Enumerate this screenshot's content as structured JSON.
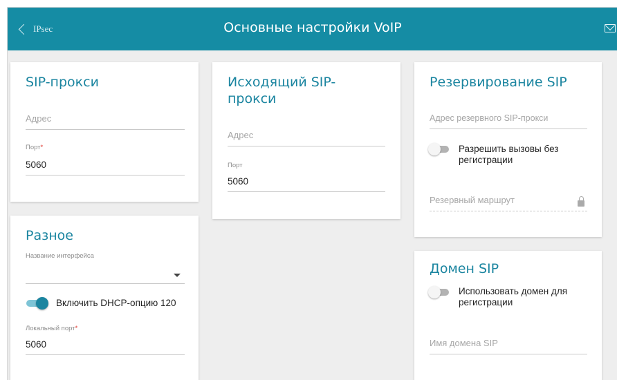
{
  "header": {
    "back_label": "IPsec",
    "title": "Основные настройки VoIP"
  },
  "sip_proxy": {
    "title": "SIP-прокси",
    "address_placeholder": "Адрес",
    "port_label": "Порт",
    "port_required": "*",
    "port_value": "5060"
  },
  "outbound_proxy": {
    "title_line1": "Исходящий SIP-",
    "title_line2": "прокси",
    "address_placeholder": "Адрес",
    "port_label": "Порт",
    "port_value": "5060"
  },
  "sip_backup": {
    "title": "Резервирование SIP",
    "backup_proxy_placeholder": "Адрес резервного SIP-прокси",
    "allow_calls_label_line1": "Разрешить вызовы без",
    "allow_calls_label_line2": "регистрации",
    "allow_calls_enabled": false,
    "backup_route_placeholder": "Резервный маршрут"
  },
  "misc": {
    "title": "Разное",
    "interface_label": "Название интерфейса",
    "interface_value": "",
    "dhcp_label": "Включить DHCP-опцию 120",
    "dhcp_enabled": true,
    "local_port_label": "Локальный порт",
    "local_port_required": "*",
    "local_port_value": "5060"
  },
  "sip_domain": {
    "title": "Домен SIP",
    "use_domain_label_line1": "Использовать домен для",
    "use_domain_label_line2": "регистрации",
    "use_domain_enabled": false,
    "domain_name_placeholder": "Имя домена SIP"
  },
  "colors": {
    "header_bg": "#158ca4",
    "accent": "#1b85a0",
    "required": "#e0322a"
  }
}
